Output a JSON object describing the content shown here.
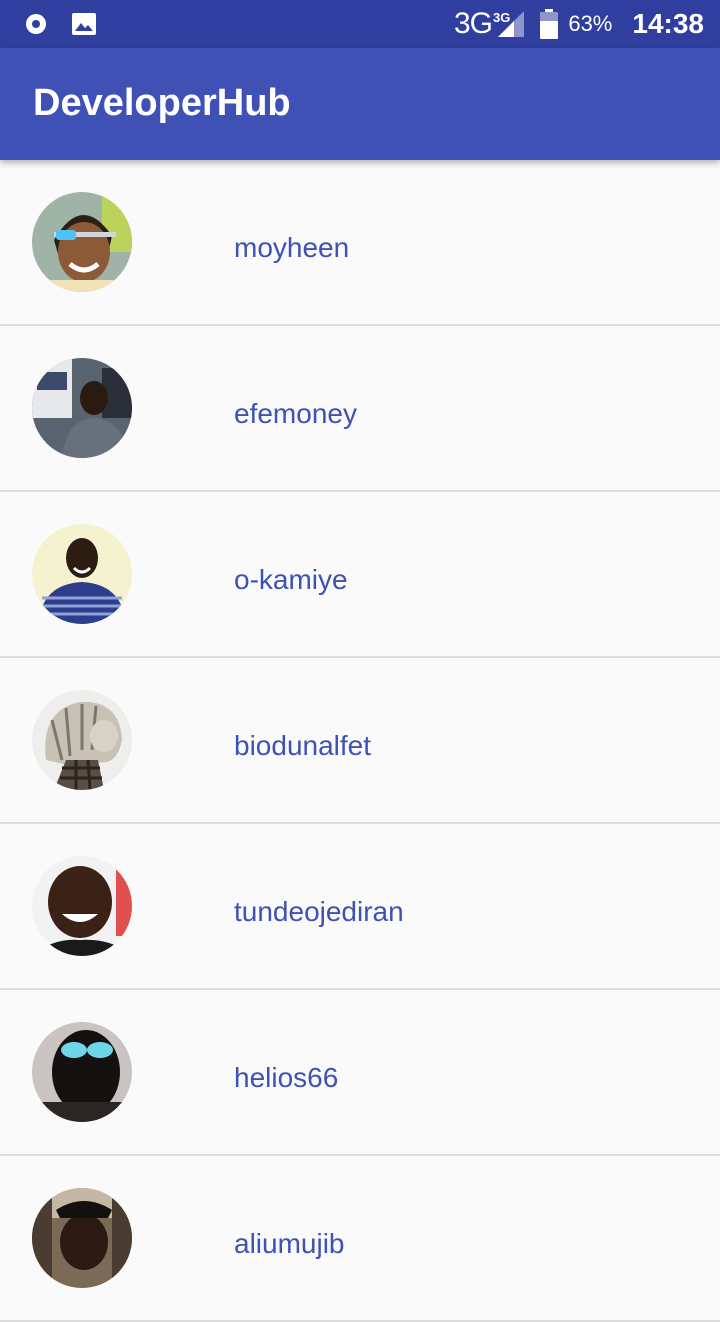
{
  "status_bar": {
    "network": "3G",
    "network_sup": "3G",
    "battery": "63%",
    "time": "14:38",
    "icons": [
      "record-icon",
      "image-icon",
      "signal-icon",
      "battery-icon"
    ]
  },
  "app_bar": {
    "title": "DeveloperHub"
  },
  "developers": [
    {
      "username": "moyheen"
    },
    {
      "username": "efemoney"
    },
    {
      "username": "o-kamiye"
    },
    {
      "username": "biodunalfet"
    },
    {
      "username": "tundeojediran"
    },
    {
      "username": "helios66"
    },
    {
      "username": "aliumujib"
    }
  ],
  "colors": {
    "primary": "#3f51b5",
    "primary_dark": "#303f9f",
    "background": "#fafafa",
    "divider": "#dcdcdc"
  }
}
